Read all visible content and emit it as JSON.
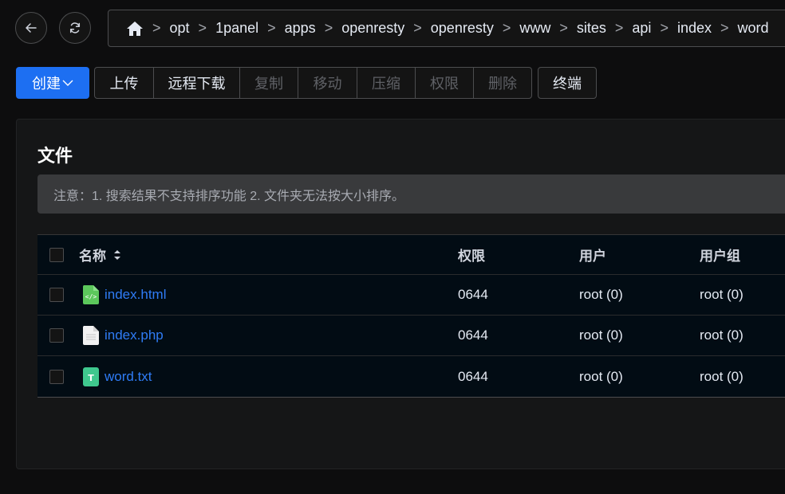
{
  "nav": {
    "breadcrumb": [
      "opt",
      "1panel",
      "apps",
      "openresty",
      "openresty",
      "www",
      "sites",
      "api",
      "index",
      "word"
    ],
    "separator": ">"
  },
  "toolbar": {
    "create_label": "创建",
    "group_buttons": [
      {
        "label": "上传",
        "enabled": true
      },
      {
        "label": "远程下载",
        "enabled": true
      },
      {
        "label": "复制",
        "enabled": false
      },
      {
        "label": "移动",
        "enabled": false
      },
      {
        "label": "压缩",
        "enabled": false
      },
      {
        "label": "权限",
        "enabled": false
      },
      {
        "label": "删除",
        "enabled": false
      }
    ],
    "terminal_label": "终端"
  },
  "card": {
    "title": "文件",
    "notice": "注意：1. 搜索结果不支持排序功能 2. 文件夹无法按大小排序。"
  },
  "table": {
    "columns": {
      "name": "名称",
      "permission": "权限",
      "user": "用户",
      "group": "用户组"
    },
    "rows": [
      {
        "name": "index.html",
        "icon": "html-file-icon",
        "permission": "0644",
        "user": "root (0)",
        "group": "root (0)"
      },
      {
        "name": "index.php",
        "icon": "text-file-icon",
        "permission": "0644",
        "user": "root (0)",
        "group": "root (0)"
      },
      {
        "name": "word.txt",
        "icon": "txt-file-icon",
        "permission": "0644",
        "user": "root (0)",
        "group": "root (0)"
      }
    ]
  },
  "colors": {
    "accent": "#1d6ff2",
    "link": "#2f7cf6",
    "background": "#0d0d0e"
  }
}
